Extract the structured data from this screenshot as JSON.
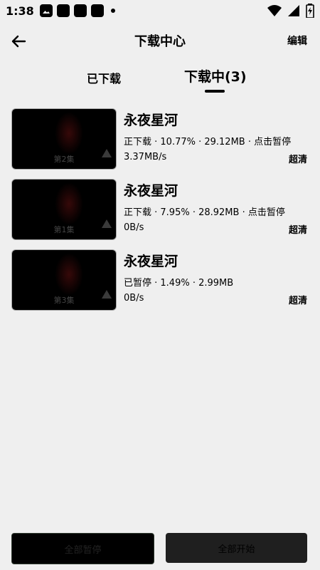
{
  "status_bar": {
    "time": "1:38"
  },
  "header": {
    "title": "下载中心",
    "edit_label": "编辑"
  },
  "tabs": [
    {
      "label": "已下载"
    },
    {
      "label": "下载中(3)"
    }
  ],
  "downloads": [
    {
      "episode": "第2集",
      "title": "永夜星河",
      "status": "正下载 · 10.77% · 29.12MB · 点击暂停",
      "speed": "3.37MB/s",
      "quality": "超清"
    },
    {
      "episode": "第1集",
      "title": "永夜星河",
      "status": "正下载 · 7.95% · 28.92MB · 点击暂停",
      "speed": "0B/s",
      "quality": "超清"
    },
    {
      "episode": "第3集",
      "title": "永夜星河",
      "status": "已暂停 · 1.49% · 2.99MB",
      "speed": "0B/s",
      "quality": "超清"
    }
  ],
  "bottom": {
    "pause_all_label": "全部暂停",
    "start_all_label": "全部开始"
  }
}
